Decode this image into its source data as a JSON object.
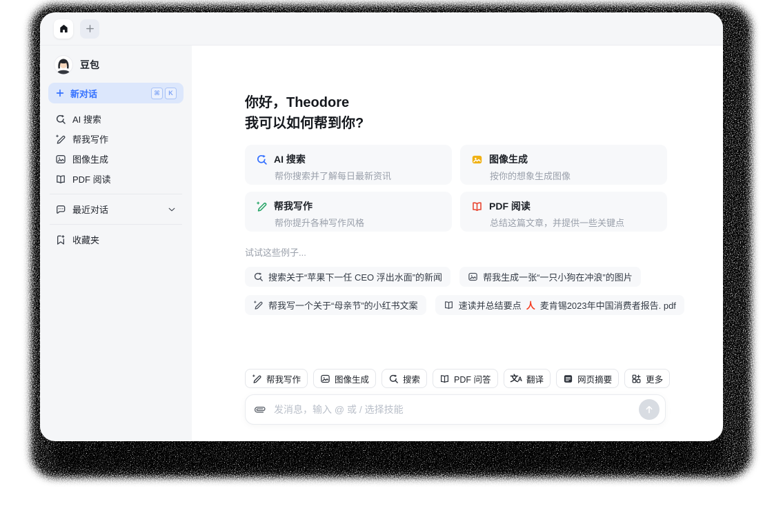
{
  "sidebar": {
    "profile": {
      "name": "豆包"
    },
    "new_chat": {
      "label": "新对话",
      "shortcut_keys": [
        "⌘",
        "K"
      ]
    },
    "items": [
      {
        "label": "AI 搜索"
      },
      {
        "label": "帮我写作"
      },
      {
        "label": "图像生成"
      },
      {
        "label": "PDF 阅读"
      }
    ],
    "recent_label": "最近对话",
    "favorites_label": "收藏夹"
  },
  "main": {
    "greeting_line1": "你好，Theodore",
    "greeting_line2": "我可以如何帮到你?",
    "cards": [
      {
        "title": "AI 搜索",
        "desc": "帮你搜索并了解每日最新资讯",
        "accent": "#3370ff"
      },
      {
        "title": "图像生成",
        "desc": "按你的想象生成图像",
        "accent": "#f0b114"
      },
      {
        "title": "帮我写作",
        "desc": "帮你提升各种写作风格",
        "accent": "#27a567"
      },
      {
        "title": "PDF 阅读",
        "desc": "总结这篇文章，并提供一些关键点",
        "accent": "#e8432e"
      }
    ],
    "examples_label": "试试这些例子...",
    "examples": [
      {
        "text": "搜索关于“苹果下一任 CEO 浮出水面”的新闻"
      },
      {
        "text": "帮我生成一张“一只小狗在冲浪”的图片"
      },
      {
        "text": "帮我写一个关于“母亲节”的小红书文案"
      },
      {
        "text": "速读并总结要点",
        "attachment": "麦肯锡2023年中国消费者报告. pdf"
      }
    ]
  },
  "composer": {
    "skills": [
      {
        "label": "帮我写作"
      },
      {
        "label": "图像生成"
      },
      {
        "label": "搜索"
      },
      {
        "label": "PDF 问答"
      },
      {
        "label": "翻译"
      },
      {
        "label": "网页摘要"
      },
      {
        "label": "更多"
      }
    ],
    "input_placeholder": "发消息，输入 @ 或 / 选择技能"
  }
}
